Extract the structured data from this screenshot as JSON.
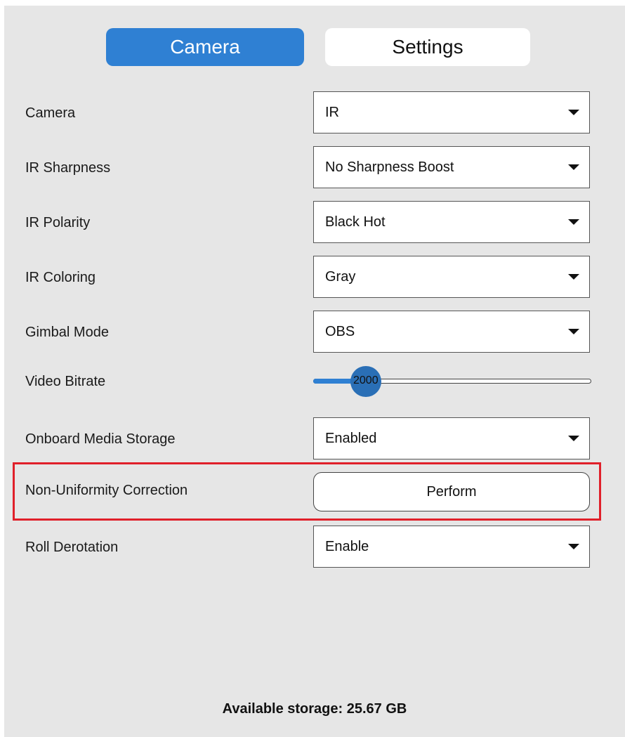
{
  "tabs": {
    "camera": "Camera",
    "settings": "Settings",
    "active": "Camera"
  },
  "settings": {
    "camera": {
      "label": "Camera",
      "value": "IR"
    },
    "ir_sharpness": {
      "label": "IR Sharpness",
      "value": "No Sharpness Boost"
    },
    "ir_polarity": {
      "label": "IR Polarity",
      "value": "Black Hot"
    },
    "ir_coloring": {
      "label": "IR Coloring",
      "value": "Gray"
    },
    "gimbal_mode": {
      "label": "Gimbal Mode",
      "value": "OBS"
    },
    "video_bitrate": {
      "label": "Video Bitrate",
      "value": "2000",
      "level_fraction": 0.19
    },
    "onboard_media_storage": {
      "label": "Onboard Media Storage",
      "value": "Enabled"
    },
    "nuc": {
      "label": "Non-Uniformity Correction",
      "button": "Perform"
    },
    "roll_derotation": {
      "label": "Roll Derotation",
      "value": "Enable"
    }
  },
  "footer": {
    "storage": "Available storage: 25.67 GB"
  },
  "colors": {
    "accent": "#2f80d3",
    "panel": "#e6e6e6",
    "highlight": "#e0202a"
  }
}
